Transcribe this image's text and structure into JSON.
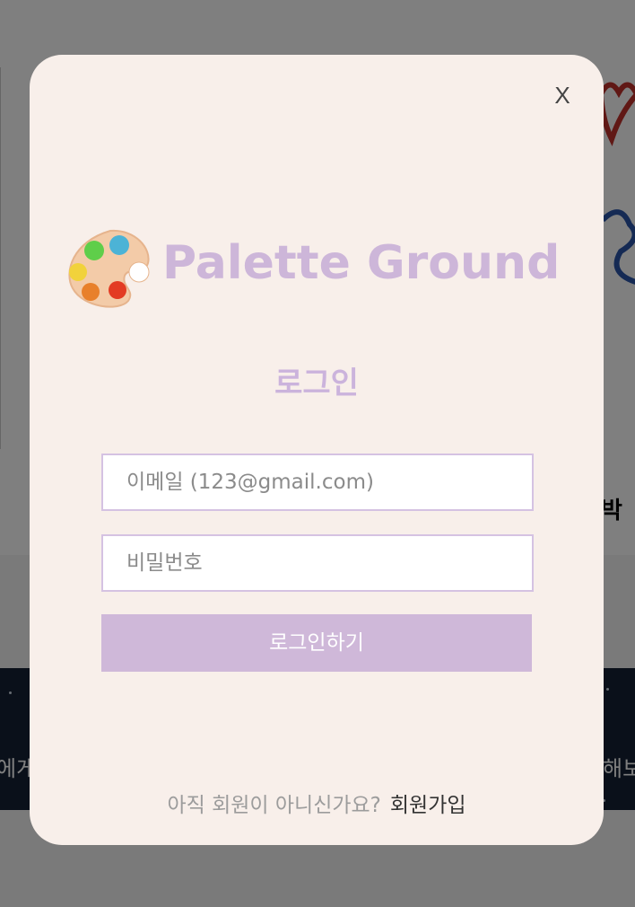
{
  "background": {
    "left_band_text": "에게",
    "right_band_text": "해보",
    "right_title_text": "박"
  },
  "modal": {
    "close_label": "X",
    "logo_text": "Palette Ground",
    "title": "로그인",
    "email_placeholder": "이메일 (123@gmail.com)",
    "password_placeholder": "비밀번호",
    "login_button_label": "로그인하기",
    "signup_question": "아직 회원이 아니신가요?",
    "signup_link": "회원가입"
  },
  "colors": {
    "modal_bg": "#f8efea",
    "accent": "#cfb8d9",
    "overlay": "#808080"
  },
  "icons": [
    "palette-icon",
    "close-icon"
  ]
}
